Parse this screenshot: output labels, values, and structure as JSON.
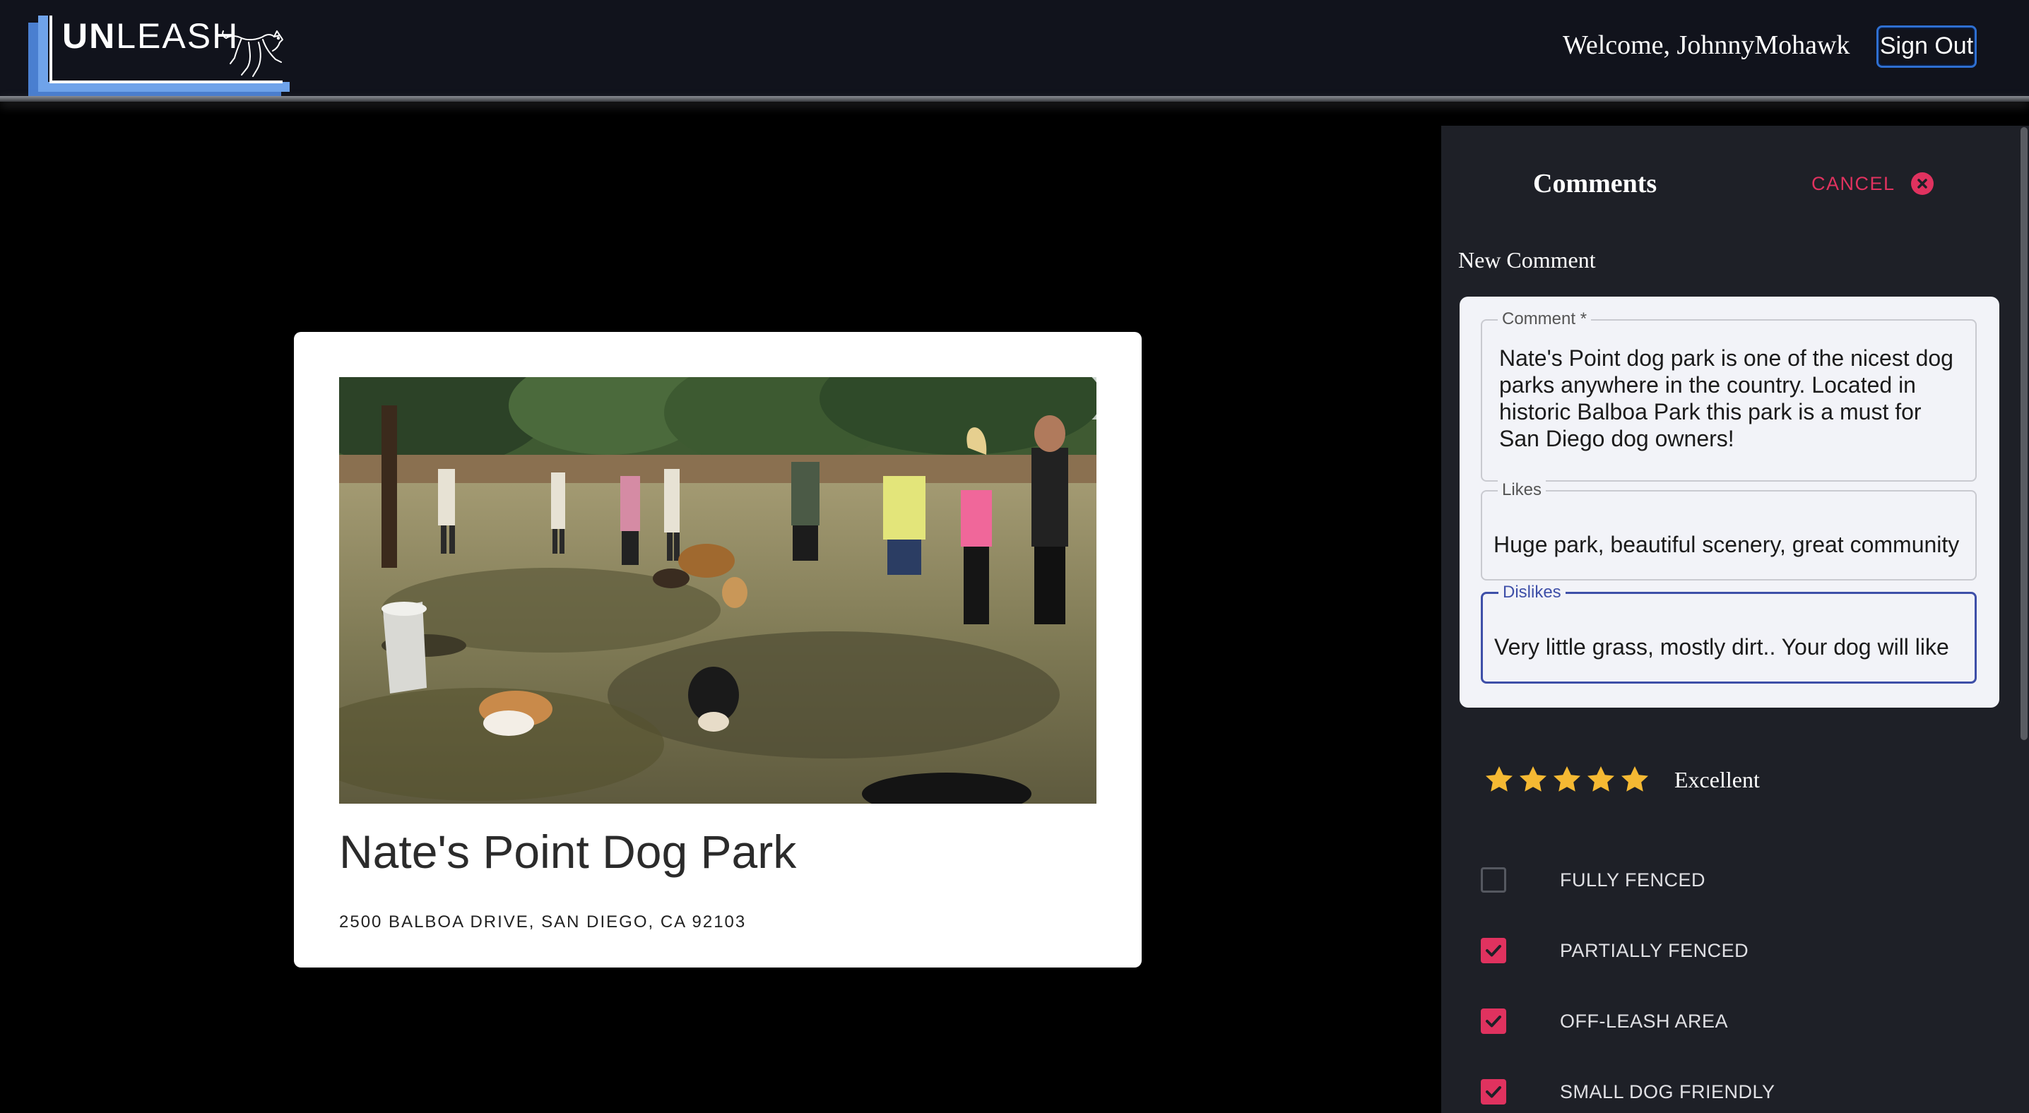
{
  "header": {
    "logo_text_bold": "UN",
    "logo_text_light": "LEASH",
    "welcome_text": "Welcome, JohnnyMohawk",
    "sign_out_label": "Sign Out"
  },
  "park": {
    "name": "Nate's Point Dog Park",
    "address": "2500 BALBOA DRIVE, SAN DIEGO, CA 92103"
  },
  "comments_panel": {
    "title": "Comments",
    "cancel_label": "CANCEL",
    "new_comment_heading": "New Comment",
    "fields": {
      "comment": {
        "label": "Comment *",
        "value": "Nate's Point dog park is one of the nicest dog parks anywhere in the country. Located in historic Balboa Park this park is a must for San Diego dog owners!"
      },
      "likes": {
        "label": "Likes",
        "value": "Huge park, beautiful scenery, great community"
      },
      "dislikes": {
        "label": "Dislikes",
        "value": "Very little grass, mostly dirt.. Your dog will like"
      }
    },
    "rating": {
      "stars": 5,
      "max": 5,
      "label": "Excellent",
      "star_color": "#f5b933"
    },
    "options": [
      {
        "label": "FULLY FENCED",
        "checked": false
      },
      {
        "label": "PARTIALLY FENCED",
        "checked": true
      },
      {
        "label": "OFF-LEASH AREA",
        "checked": true
      },
      {
        "label": "SMALL DOG FRIENDLY",
        "checked": true
      }
    ]
  },
  "colors": {
    "accent": "#e0325f",
    "focus": "#3e4fa8",
    "header_bg": "#11131c",
    "panel_bg": "#1e2027"
  }
}
